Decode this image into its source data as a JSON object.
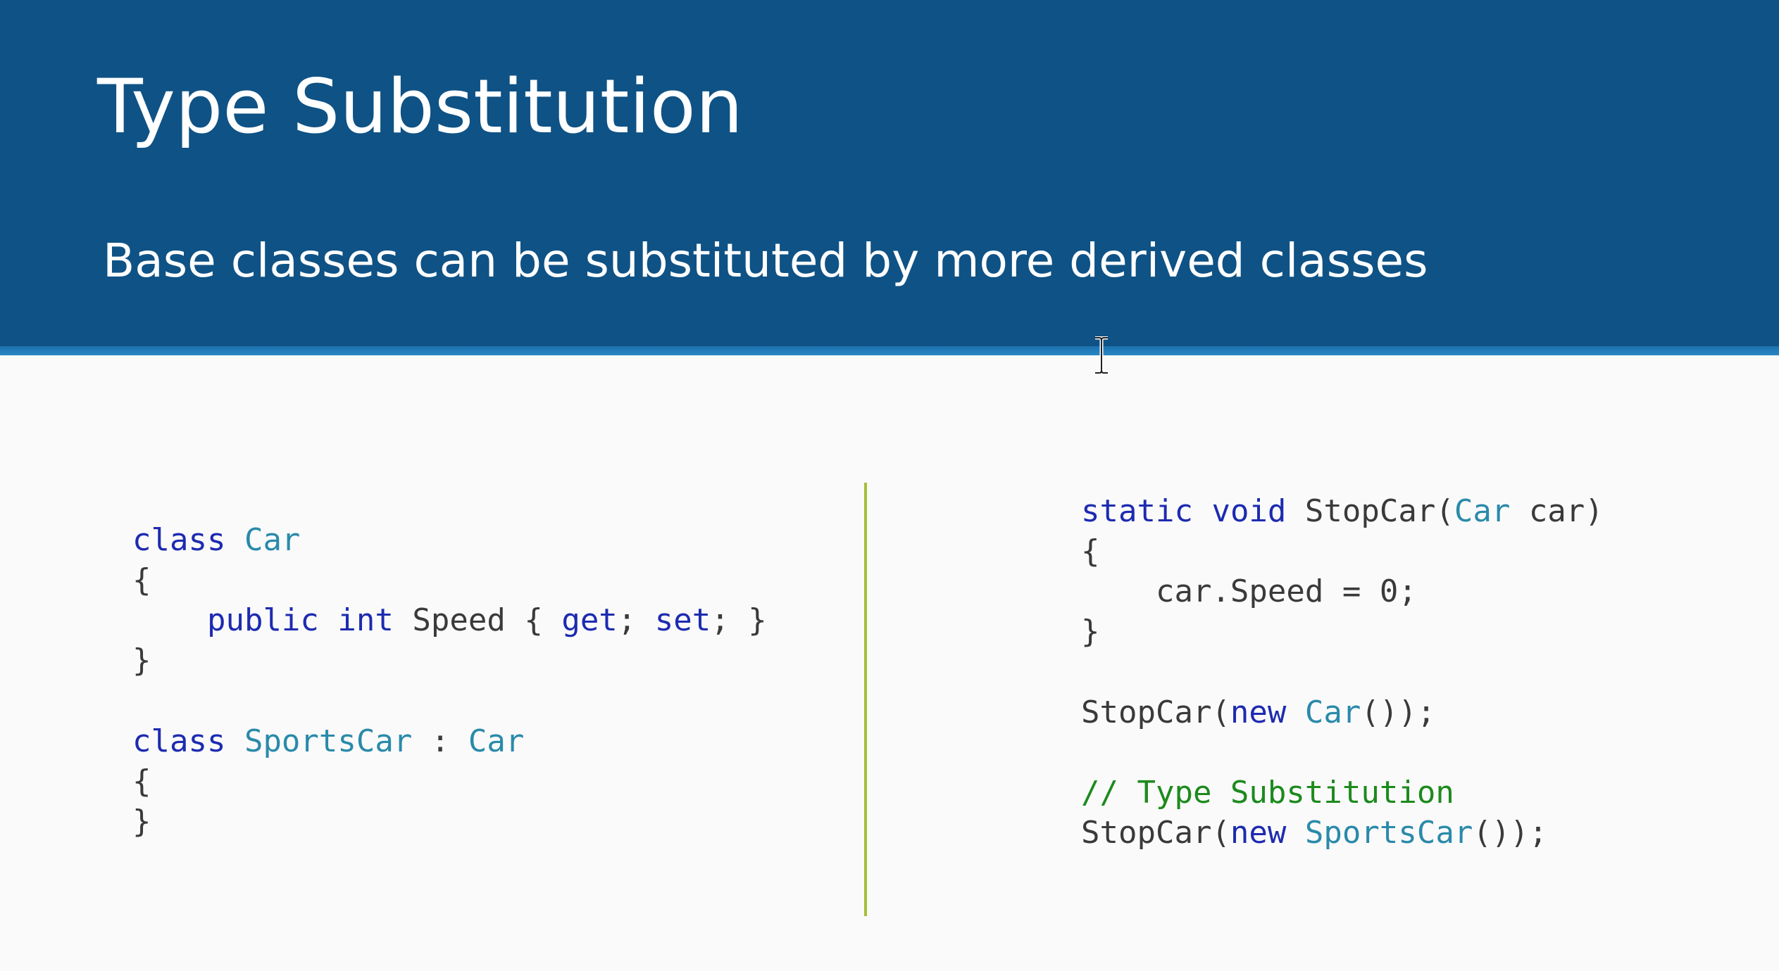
{
  "slide": {
    "title": "Type Substitution",
    "subtitle": "Base classes can be substituted by more derived classes"
  },
  "colors": {
    "header_background": "#0f5285",
    "header_stripe": "#2a87c5",
    "divider": "#a3bf3a",
    "keyword": "#1d2bb0",
    "type": "#2a8aaa",
    "comment": "#1d8a1d",
    "plain_text": "#3a3a3a"
  },
  "left_code": {
    "l1": {
      "a": "class",
      "b": " ",
      "c": "Car"
    },
    "l2": {
      "a": "{"
    },
    "l3": {
      "a": "    ",
      "b": "public",
      "c": " ",
      "d": "int",
      "e": " Speed { ",
      "f": "get",
      "g": "; ",
      "h": "set",
      "i": "; }"
    },
    "l4": {
      "a": "}"
    },
    "l6": {
      "a": "class",
      "b": " ",
      "c": "SportsCar",
      "d": " : ",
      "e": "Car"
    },
    "l7": {
      "a": "{"
    },
    "l8": {
      "a": "}"
    }
  },
  "right_code": {
    "l1": {
      "a": "static",
      "b": " ",
      "c": "void",
      "d": " StopCar(",
      "e": "Car",
      "f": " car)"
    },
    "l2": {
      "a": "{"
    },
    "l3": {
      "a": "    car.Speed = 0;"
    },
    "l4": {
      "a": "}"
    },
    "l6": {
      "a": "StopCar(",
      "b": "new",
      "c": " ",
      "d": "Car",
      "e": "());"
    },
    "l8": {
      "a": "// Type Substitution"
    },
    "l9": {
      "a": "StopCar(",
      "b": "new",
      "c": " ",
      "d": "SportsCar",
      "e": "());"
    }
  },
  "icons": {
    "cursor": "text-cursor-icon"
  }
}
